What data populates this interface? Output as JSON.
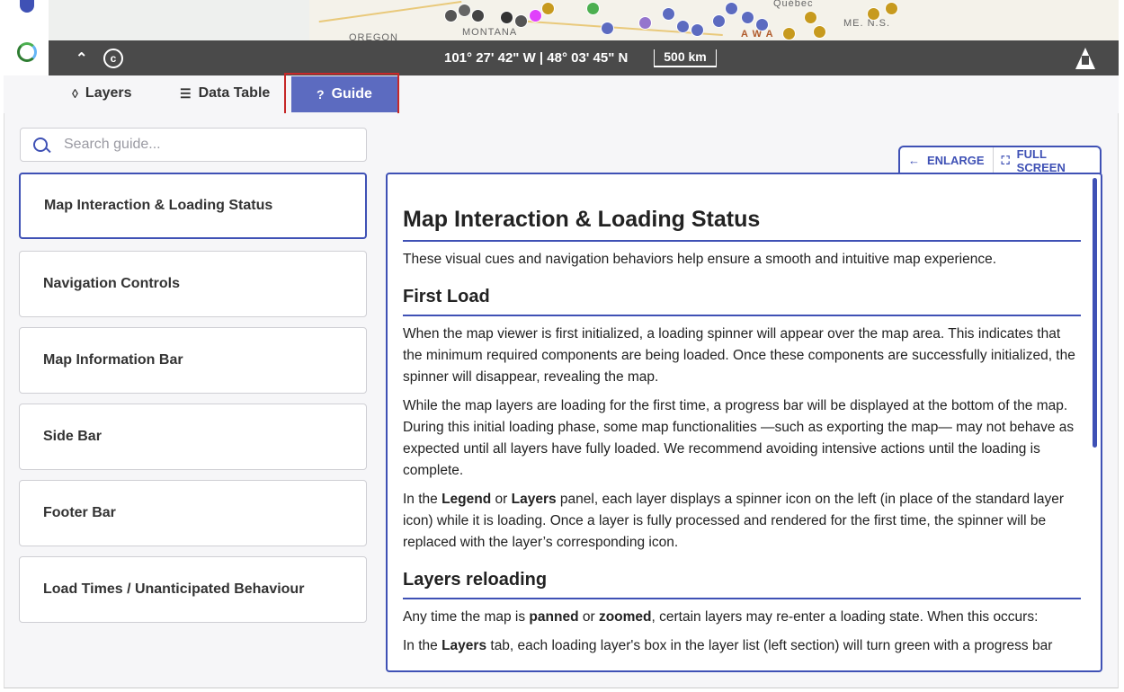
{
  "map": {
    "labels": [
      "OREGON",
      "MONTANA",
      "Québec",
      "A W A",
      "ME. N.S."
    ],
    "coordinates": "101° 27' 42\" W | 48° 03' 45\" N",
    "scale": "500 km"
  },
  "tabs": [
    {
      "label": "Layers",
      "icon": "layers-icon"
    },
    {
      "label": "Data Table",
      "icon": "list-icon"
    },
    {
      "label": "Guide",
      "icon": "help-icon"
    }
  ],
  "guide": {
    "search_placeholder": "Search guide...",
    "items": [
      "Map Interaction & Loading Status",
      "Navigation Controls",
      "Map Information Bar",
      "Side Bar",
      "Footer Bar",
      "Load Times / Unanticipated Behaviour"
    ],
    "enlarge_label": "ENLARGE",
    "fullscreen_label": "FULL SCREEN"
  },
  "article": {
    "title": "Map Interaction & Loading Status",
    "intro": "These visual cues and navigation behaviors help ensure a smooth and intuitive map experience.",
    "s1_title": "First Load",
    "s1_p1": "When the map viewer is first initialized, a loading spinner will appear over the map area. This indicates that the minimum required components are being loaded. Once these components are successfully initialized, the spinner will disappear, revealing the map.",
    "s1_p2": "While the map layers are loading for the first time, a progress bar will be displayed at the bottom of the map. During this initial loading phase, some map functionalities —such as exporting the map— may not behave as expected until all layers have fully loaded. We recommend avoiding intensive actions until the loading is complete.",
    "s1_p3_a": "In the ",
    "s1_p3_b1": "Legend",
    "s1_p3_c": " or ",
    "s1_p3_b2": "Layers",
    "s1_p3_d": " panel, each layer displays a spinner icon on the left (in place of the standard layer icon) while it is loading. Once a layer is fully processed and rendered for the first time, the spinner will be replaced with the layer’s corresponding icon.",
    "s2_title": "Layers reloading",
    "s2_p1_a": "Any time the map is ",
    "s2_p1_b1": "panned",
    "s2_p1_c": " or ",
    "s2_p1_b2": "zoomed",
    "s2_p1_d": ", certain layers may re-enter a loading state. When this occurs:",
    "s2_p2_a": "In the ",
    "s2_p2_b": "Layers",
    "s2_p2_c": " tab, each loading layer's box in the layer list (left section) will turn green with a progress bar"
  }
}
